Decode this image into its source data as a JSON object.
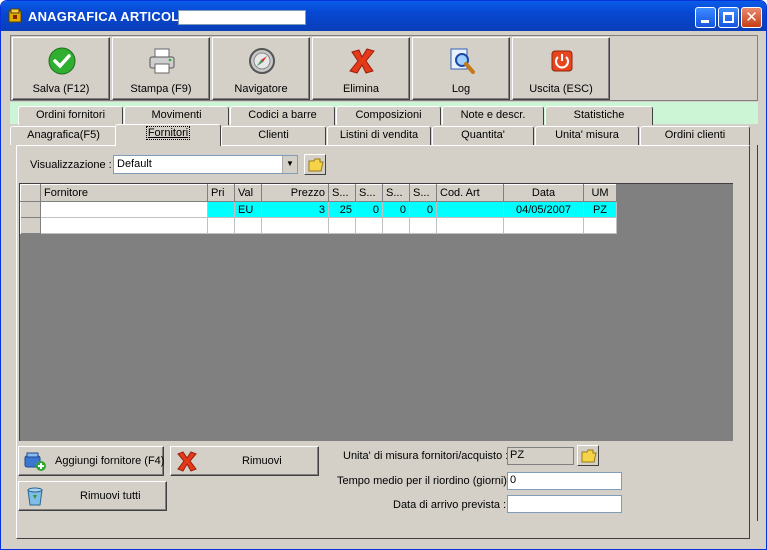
{
  "window": {
    "title": "ANAGRAFICA ARTICOLI -",
    "title_field_value": ""
  },
  "toolbar": {
    "buttons": [
      {
        "label": "Salva (F12)",
        "icon": "check-icon"
      },
      {
        "label": "Stampa (F9)",
        "icon": "printer-icon"
      },
      {
        "label": "Navigatore",
        "icon": "compass-icon"
      },
      {
        "label": "Elimina",
        "icon": "delete-x-icon"
      },
      {
        "label": "Log",
        "icon": "magnifier-icon"
      },
      {
        "label": "Uscita (ESC)",
        "icon": "power-icon"
      }
    ]
  },
  "tabs": {
    "back_row": [
      "Ordini fornitori",
      "Movimenti",
      "Codici a barre",
      "Composizioni",
      "Note e descr.",
      "Statistiche"
    ],
    "front_row": [
      "Anagrafica(F5)",
      "Fornitori",
      "Clienti",
      "Listini di vendita",
      "Quantita'",
      "Unita' misura",
      "Ordini clienti"
    ],
    "active": "Fornitori"
  },
  "view": {
    "label": "Visualizzazione :",
    "value": "Default"
  },
  "grid": {
    "columns": [
      "Fornitore",
      "Pri",
      "Val",
      "Prezzo",
      "S...",
      "S...",
      "S...",
      "S...",
      "Cod. Art",
      "Data",
      "UM"
    ],
    "rows": [
      [
        "",
        "",
        "EU",
        "3",
        "25",
        "0",
        "0",
        "0",
        "",
        "04/05/2007",
        "PZ"
      ],
      [
        "",
        "",
        "",
        "",
        "",
        "",
        "",
        "",
        "",
        "",
        ""
      ]
    ]
  },
  "buttons": {
    "add_supplier": "Aggiungi fornitore (F4)",
    "remove": "Rimuovi",
    "remove_all": "Rimuovi tutti"
  },
  "fields": {
    "unit_label": "Unita' di misura fornitori/acquisto :",
    "unit_value": "PZ",
    "reorder_label": "Tempo medio per il riordino (giorni) :",
    "reorder_value": "0",
    "arrival_label": "Data di arrivo prevista :",
    "arrival_value": ""
  },
  "colors": {
    "selected_row": "#00ffff",
    "title_blue": "#0747d2",
    "green_strip": "#ccf5d6"
  }
}
